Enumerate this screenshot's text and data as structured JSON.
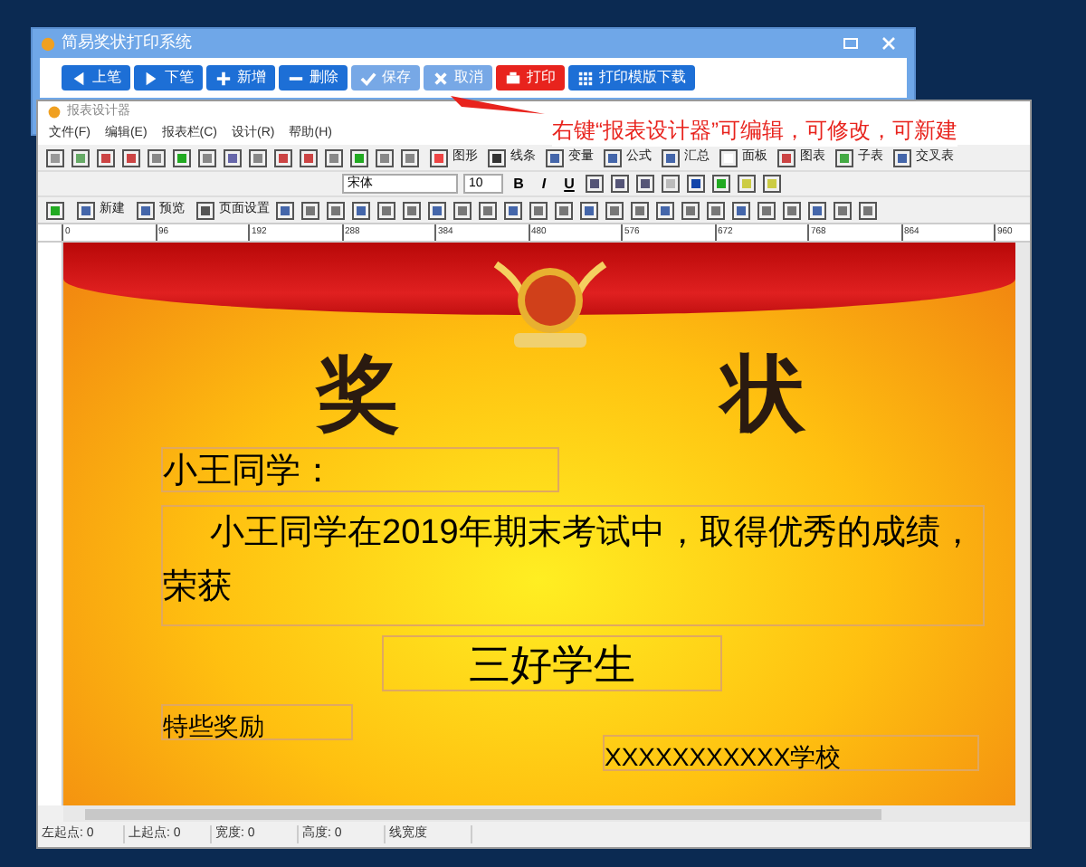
{
  "main_window": {
    "title": "简易奖状打印系统",
    "buttons": [
      {
        "label": "上笔",
        "kind": "left",
        "disabled": false,
        "highlighted": false
      },
      {
        "label": "下笔",
        "kind": "right",
        "disabled": false,
        "highlighted": false
      },
      {
        "label": "新增",
        "kind": "plus",
        "disabled": false,
        "highlighted": false
      },
      {
        "label": "删除",
        "kind": "minus",
        "disabled": false,
        "highlighted": false
      },
      {
        "label": "保存",
        "kind": "check",
        "disabled": true,
        "highlighted": false
      },
      {
        "label": "取消",
        "kind": "x",
        "disabled": true,
        "highlighted": false
      },
      {
        "label": "打印",
        "kind": "print",
        "disabled": false,
        "highlighted": true
      },
      {
        "label": "打印模版下载",
        "kind": "grid",
        "disabled": false,
        "highlighted": false
      }
    ]
  },
  "annotation": "右键“报表设计器”可编辑，可修改，可新建",
  "designer": {
    "title": "报表设计器",
    "menu": [
      "文件(F)",
      "编辑(E)",
      "报表栏(C)",
      "设计(R)",
      "帮助(H)"
    ],
    "toolbar_1": [
      "图形",
      "线条",
      "变量",
      "公式",
      "汇总",
      "面板",
      "图表",
      "子表",
      "交叉表"
    ],
    "font_name": "宋体",
    "font_size": "10",
    "format_buttons": [
      "B",
      "I",
      "U"
    ],
    "toolbar_3": [
      "新建",
      "预览",
      "页面设置"
    ],
    "ruler": [
      "0",
      "96",
      "192",
      "288",
      "384",
      "480",
      "576",
      "672",
      "768",
      "864",
      "960"
    ],
    "certificate": {
      "heading": [
        "奖",
        "状"
      ],
      "greeting": "小王同学：",
      "body": "小王同学在2019年期末考试中，取得优秀的成绩，荣获",
      "award": "三好学生",
      "reward": "特些奖励",
      "school": "XXXXXXXXXXX学校"
    },
    "status_bar": [
      "左起点: 0",
      "上起点: 0",
      "宽度: 0",
      "高度: 0",
      "线宽度"
    ]
  }
}
